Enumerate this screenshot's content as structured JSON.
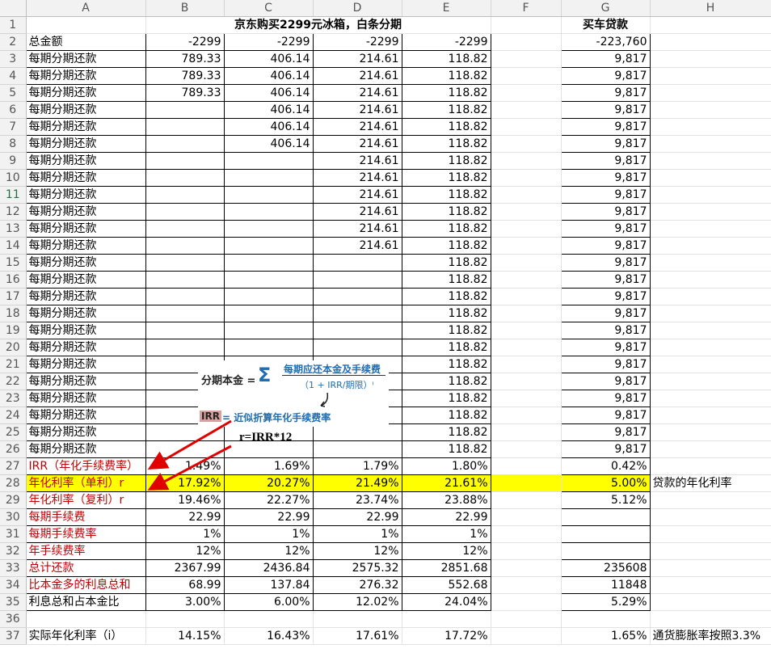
{
  "columns": [
    "A",
    "B",
    "C",
    "D",
    "E",
    "F",
    "G",
    "H"
  ],
  "selected_row": "11",
  "title": "京东购买2299元冰箱，白条分期",
  "car_title": "买车贷款",
  "rows": [
    {
      "n": "2",
      "a": "总金额",
      "b": "-2299",
      "c": "-2299",
      "d": "-2299",
      "e": "-2299",
      "g": "-223,760"
    },
    {
      "n": "3",
      "a": "每期分期还款",
      "b": "789.33",
      "c": "406.14",
      "d": "214.61",
      "e": "118.82",
      "g": "9,817"
    },
    {
      "n": "4",
      "a": "每期分期还款",
      "b": "789.33",
      "c": "406.14",
      "d": "214.61",
      "e": "118.82",
      "g": "9,817"
    },
    {
      "n": "5",
      "a": "每期分期还款",
      "b": "789.33",
      "c": "406.14",
      "d": "214.61",
      "e": "118.82",
      "g": "9,817"
    },
    {
      "n": "6",
      "a": "每期分期还款",
      "b": "",
      "c": "406.14",
      "d": "214.61",
      "e": "118.82",
      "g": "9,817"
    },
    {
      "n": "7",
      "a": "每期分期还款",
      "b": "",
      "c": "406.14",
      "d": "214.61",
      "e": "118.82",
      "g": "9,817"
    },
    {
      "n": "8",
      "a": "每期分期还款",
      "b": "",
      "c": "406.14",
      "d": "214.61",
      "e": "118.82",
      "g": "9,817"
    },
    {
      "n": "9",
      "a": "每期分期还款",
      "b": "",
      "c": "",
      "d": "214.61",
      "e": "118.82",
      "g": "9,817"
    },
    {
      "n": "10",
      "a": "每期分期还款",
      "b": "",
      "c": "",
      "d": "214.61",
      "e": "118.82",
      "g": "9,817"
    },
    {
      "n": "11",
      "a": "每期分期还款",
      "b": "",
      "c": "",
      "d": "214.61",
      "e": "118.82",
      "g": "9,817"
    },
    {
      "n": "12",
      "a": "每期分期还款",
      "b": "",
      "c": "",
      "d": "214.61",
      "e": "118.82",
      "g": "9,817"
    },
    {
      "n": "13",
      "a": "每期分期还款",
      "b": "",
      "c": "",
      "d": "214.61",
      "e": "118.82",
      "g": "9,817"
    },
    {
      "n": "14",
      "a": "每期分期还款",
      "b": "",
      "c": "",
      "d": "214.61",
      "e": "118.82",
      "g": "9,817"
    },
    {
      "n": "15",
      "a": "每期分期还款",
      "b": "",
      "c": "",
      "d": "",
      "e": "118.82",
      "g": "9,817"
    },
    {
      "n": "16",
      "a": "每期分期还款",
      "b": "",
      "c": "",
      "d": "",
      "e": "118.82",
      "g": "9,817"
    },
    {
      "n": "17",
      "a": "每期分期还款",
      "b": "",
      "c": "",
      "d": "",
      "e": "118.82",
      "g": "9,817"
    },
    {
      "n": "18",
      "a": "每期分期还款",
      "b": "",
      "c": "",
      "d": "",
      "e": "118.82",
      "g": "9,817"
    },
    {
      "n": "19",
      "a": "每期分期还款",
      "b": "",
      "c": "",
      "d": "",
      "e": "118.82",
      "g": "9,817"
    },
    {
      "n": "20",
      "a": "每期分期还款",
      "b": "",
      "c": "",
      "d": "",
      "e": "118.82",
      "g": "9,817"
    },
    {
      "n": "21",
      "a": "每期分期还款",
      "b": "",
      "c": "",
      "d": "",
      "e": "118.82",
      "g": "9,817"
    },
    {
      "n": "22",
      "a": "每期分期还款",
      "b": "",
      "c": "",
      "d": "",
      "e": "118.82",
      "g": "9,817"
    },
    {
      "n": "23",
      "a": "每期分期还款",
      "b": "",
      "c": "",
      "d": "",
      "e": "118.82",
      "g": "9,817"
    },
    {
      "n": "24",
      "a": "每期分期还款",
      "b": "",
      "c": "",
      "d": "",
      "e": "118.82",
      "g": "9,817"
    },
    {
      "n": "25",
      "a": "每期分期还款",
      "b": "",
      "c": "",
      "d": "",
      "e": "118.82",
      "g": "9,817"
    },
    {
      "n": "26",
      "a": "每期分期还款",
      "b": "",
      "c": "",
      "d": "",
      "e": "118.82",
      "g": "9,817"
    }
  ],
  "summary": [
    {
      "n": "27",
      "a": "IRR（年化手续费率）",
      "b": "1.49%",
      "c": "1.69%",
      "d": "1.79%",
      "e": "1.80%",
      "g": "0.42%",
      "h": "",
      "red": true,
      "yellow": false,
      "pct": true
    },
    {
      "n": "28",
      "a": "年化利率（单利）r",
      "b": "17.92%",
      "c": "20.27%",
      "d": "21.49%",
      "e": "21.61%",
      "g": "5.00%",
      "h": "贷款的年化利率",
      "red": true,
      "yellow": true,
      "pct": true
    },
    {
      "n": "29",
      "a": "年化利率（复利）r",
      "b": "19.46%",
      "c": "22.27%",
      "d": "23.74%",
      "e": "23.88%",
      "g": "5.12%",
      "h": "",
      "red": true,
      "yellow": false,
      "pct": true
    },
    {
      "n": "30",
      "a": "每期手续费",
      "b": "22.99",
      "c": "22.99",
      "d": "22.99",
      "e": "22.99",
      "g": "",
      "h": "",
      "red": true,
      "yellow": false,
      "pct": false
    },
    {
      "n": "31",
      "a": "每期手续费率",
      "b": "1%",
      "c": "1%",
      "d": "1%",
      "e": "1%",
      "g": "",
      "h": "",
      "red": true,
      "yellow": false,
      "pct": true
    },
    {
      "n": "32",
      "a": "年手续费率",
      "b": "12%",
      "c": "12%",
      "d": "12%",
      "e": "12%",
      "g": "",
      "h": "",
      "red": true,
      "yellow": false,
      "pct": true
    },
    {
      "n": "33",
      "a": "总计还款",
      "b": "2367.99",
      "c": "2436.84",
      "d": "2575.32",
      "e": "2851.68",
      "g": "235608",
      "h": "",
      "red": true,
      "yellow": false,
      "pct": false
    },
    {
      "n": "34",
      "a": "比本金多的利息总和",
      "b": "68.99",
      "c": "137.84",
      "d": "276.32",
      "e": "552.68",
      "g": "11848",
      "h": "",
      "red": true,
      "yellow": false,
      "pct": false
    },
    {
      "n": "35",
      "a": "利息总和占本金比",
      "b": "3.00%",
      "c": "6.00%",
      "d": "12.02%",
      "e": "24.04%",
      "g": "5.29%",
      "h": "",
      "red": false,
      "yellow": false,
      "pct": true
    }
  ],
  "row36": "36",
  "row37": {
    "n": "37",
    "a": "实际年化利率（i）",
    "b": "14.15%",
    "c": "16.43%",
    "d": "17.61%",
    "e": "17.72%",
    "g": "1.65%",
    "h": "通货膨胀率按照3.3%"
  },
  "overlay": {
    "left_label": "分期本金 =",
    "sigma": "Σ",
    "numerator": "每期应还本金及手续费",
    "denominator": "（1 + IRR/期限）ⁱ",
    "irr_tag": "IRR",
    "irr_desc": "= 近似折算年化手续费率",
    "formula": "r=IRR*12"
  },
  "colors": {
    "yellow": "#ffff00",
    "red": "#c00000",
    "arrow": "#e00000",
    "blue": "#1f6cb0"
  }
}
